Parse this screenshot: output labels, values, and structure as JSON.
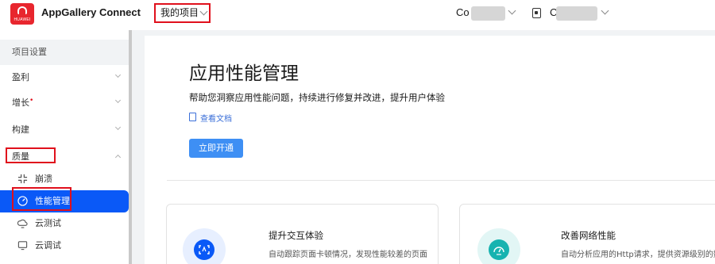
{
  "header": {
    "brand_text": "HUAWEI",
    "app_title": "AppGallery Connect",
    "project_select": "我的项目",
    "account_a": "Co",
    "account_b": "C"
  },
  "sidebar": {
    "heading": "项目设置",
    "items": [
      {
        "label": "盈利"
      },
      {
        "label": "增长",
        "badge": "•"
      },
      {
        "label": "构建"
      },
      {
        "label": "质量"
      }
    ],
    "sub_items": [
      {
        "label": "崩溃",
        "icon": "crash-icon"
      },
      {
        "label": "性能管理",
        "icon": "performance-icon",
        "active": true
      },
      {
        "label": "云测试",
        "icon": "cloud-test-icon"
      },
      {
        "label": "云调试",
        "icon": "cloud-debug-icon"
      }
    ]
  },
  "main": {
    "title": "应用性能管理",
    "subtitle": "帮助您洞察应用性能问题，持续进行修复并改进，提升用户体验",
    "doc_link": "查看文档",
    "cta": "立即开通"
  },
  "features": [
    {
      "title": "提升交互体验",
      "desc": "自动跟踪页面卡顿情况，发现性能较差的页面，提供提示和的环境信息，帮",
      "icon": "interaction-icon",
      "color": "#0a59f7",
      "bg": "#e7efff"
    },
    {
      "title": "改善网络性能",
      "desc": "自动分析应用的Http请求，提供资源级别的数据分析，了解网络的状况，帮",
      "icon": "network-icon",
      "color": "#17b3b0",
      "bg": "#e2f6f5"
    }
  ],
  "colors": {
    "accent": "#0a59f7",
    "highlight": "#e0101c",
    "cta": "#3e8ff4"
  }
}
